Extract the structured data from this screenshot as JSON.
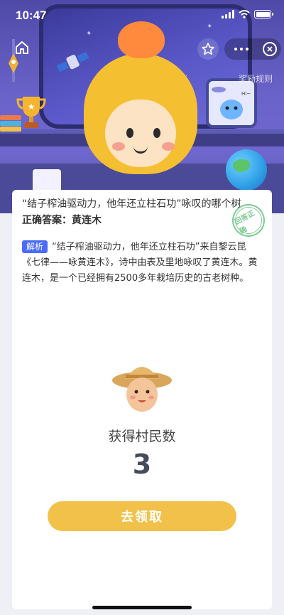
{
  "status_bar": {
    "time": "10:47"
  },
  "header": {
    "reward_rules_label": "奖励规则"
  },
  "question": {
    "text": "“结子榨油驱动力，他年还立柱石功”咏叹的哪个树",
    "answer_prefix": "正确答案：",
    "answer": "黄连木",
    "stamp_text": "回答正确"
  },
  "analysis": {
    "tag": "解析",
    "text": "“结子榨油驱动力，他年还立柱石功”来自黎云昆《七律——咏黄连木》，诗中由表及里地咏叹了黄连木。黄连木，是一个已经拥有2500多年栽培历史的古老树种。"
  },
  "reward": {
    "label": "获得村民数",
    "count": "3",
    "claim_button": "去领取"
  },
  "colors": {
    "accent": "#f2c14a",
    "tag": "#4b6bff",
    "stamp": "#6fc68a",
    "header_bg": "#5b57c2"
  }
}
